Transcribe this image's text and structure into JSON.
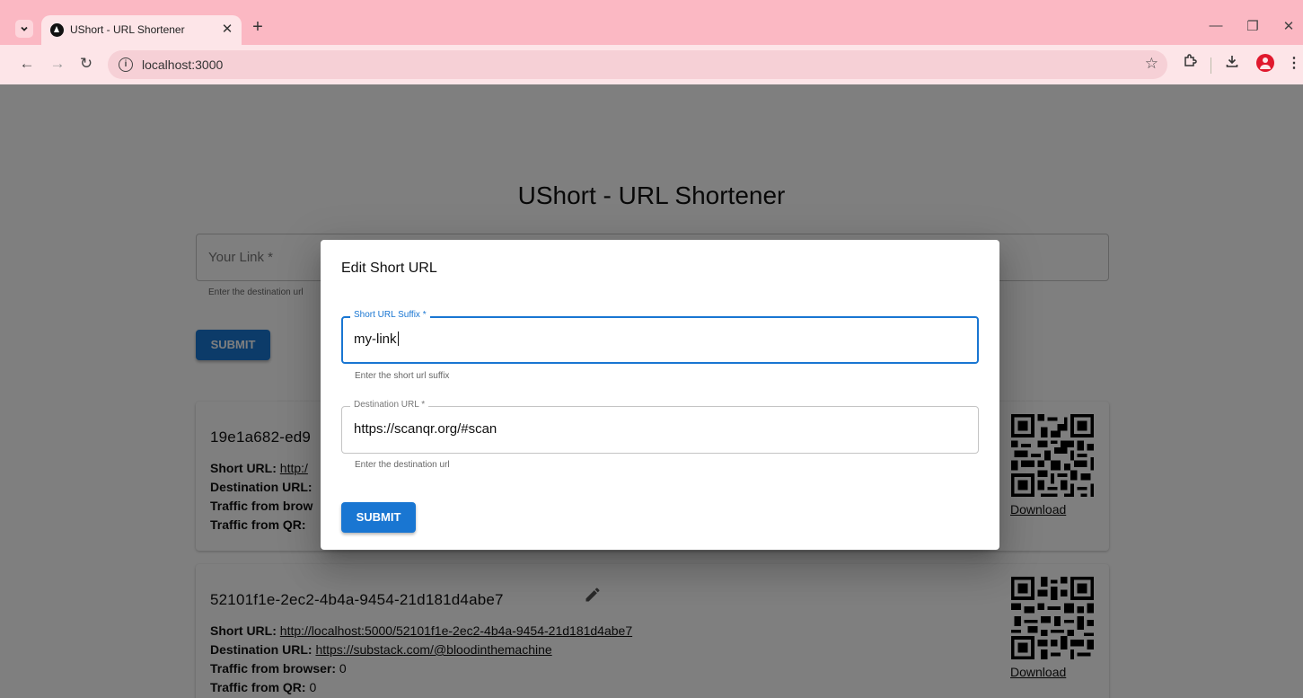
{
  "browser": {
    "tab_title": "UShort - URL Shortener",
    "address": "localhost:3000",
    "accent_color": "#fbb8c3"
  },
  "page": {
    "title": "UShort - URL Shortener",
    "link_field": {
      "label": "Your Link *",
      "helper": "Enter the destination url"
    },
    "submit_label": "SUBMIT",
    "cards": [
      {
        "id": "19e1a682-ed9",
        "short_url_label": "Short URL:",
        "short_url": "http:/",
        "destination_label": "Destination URL:",
        "destination": "",
        "browser_traffic_label": "Traffic from brow",
        "browser_traffic": "",
        "qr_traffic_label": "Traffic from QR:",
        "qr_traffic": "",
        "download_label": "Download"
      },
      {
        "id": "52101f1e-2ec2-4b4a-9454-21d181d4abe7",
        "short_url_label": "Short URL:",
        "short_url": "http://localhost:5000/52101f1e-2ec2-4b4a-9454-21d181d4abe7",
        "destination_label": "Destination URL:",
        "destination": "https://substack.com/@bloodinthemachine",
        "browser_traffic_label": "Traffic from browser:",
        "browser_traffic": "0",
        "qr_traffic_label": "Traffic from QR:",
        "qr_traffic": "0",
        "download_label": "Download"
      }
    ]
  },
  "dialog": {
    "title": "Edit Short URL",
    "suffix_field": {
      "label": "Short URL Suffix *",
      "value": "my-link",
      "helper": "Enter the short url suffix"
    },
    "destination_field": {
      "label": "Destination URL *",
      "value": "https://scanqr.org/#scan",
      "helper": "Enter the destination url"
    },
    "submit_label": "SUBMIT",
    "primary_color": "#1976d2"
  }
}
